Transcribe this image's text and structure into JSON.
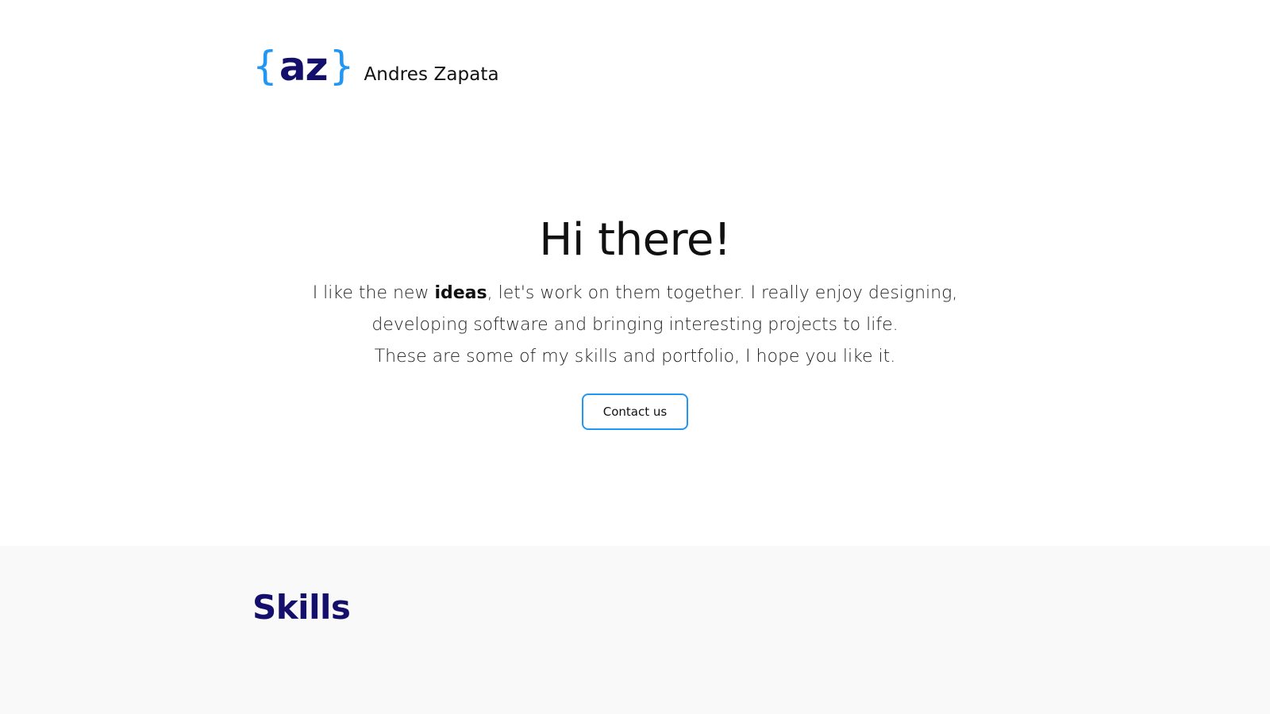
{
  "header": {
    "logo": {
      "brace_open": "{",
      "letters": "az",
      "brace_close": "}"
    },
    "brand_name": "Andres Zapata"
  },
  "hero": {
    "title": "Hi there!",
    "text": {
      "line1_pre": "I like the new ",
      "line1_bold": "ideas",
      "line1_post": ", let's work on them together. I really enjoy designing,",
      "line2": "developing software and bringing interesting projects to life.",
      "line3": "These are some of my skills and portfolio, I hope you like it."
    },
    "cta_label": "Contact us"
  },
  "skills": {
    "title": "Skills"
  },
  "colors": {
    "brand_dark": "#130f6b",
    "brand_accent": "#2196f3",
    "section_bg": "#f9f9f9"
  }
}
